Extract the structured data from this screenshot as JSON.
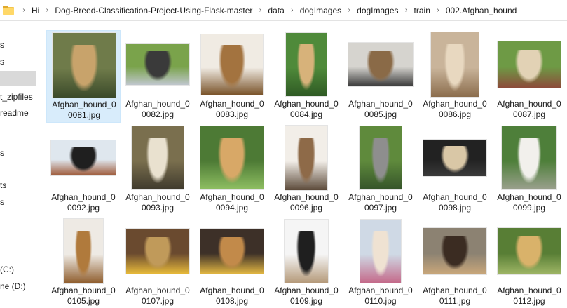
{
  "breadcrumb": {
    "items": [
      "Hi",
      "Dog-Breed-Classification-Project-Using-Flask-master",
      "data",
      "dogImages",
      "dogImages",
      "train",
      "002.Afghan_hound"
    ]
  },
  "nav": {
    "items": [
      {
        "label": "s"
      },
      {
        "label": "s"
      },
      {
        "label": ""
      },
      {
        "label": "t_zipfiles"
      },
      {
        "label": "readme"
      },
      {
        "label": ""
      },
      {
        "label": "s"
      },
      {
        "label": ""
      },
      {
        "label": "ts"
      },
      {
        "label": "s"
      },
      {
        "label": "(C:)"
      },
      {
        "label": "ne (D:)"
      }
    ]
  },
  "files": [
    {
      "line1": "Afghan_hound_0",
      "line2": "0081.jpg",
      "selected": true,
      "colors": [
        "#6f7b4a",
        "#c8a36b",
        "#3b4a2a"
      ]
    },
    {
      "line1": "Afghan_hound_0",
      "line2": "0082.jpg",
      "selected": false,
      "colors": [
        "#7aa34b",
        "#3a3a3a",
        "#bfc6cc"
      ]
    },
    {
      "line1": "Afghan_hound_0",
      "line2": "0083.jpg",
      "selected": false,
      "colors": [
        "#f0ebe3",
        "#a3733f",
        "#7a542b"
      ]
    },
    {
      "line1": "Afghan_hound_0",
      "line2": "0084.jpg",
      "selected": false,
      "colors": [
        "#4f8a3a",
        "#d7b27a",
        "#2f5a24"
      ]
    },
    {
      "line1": "Afghan_hound_0",
      "line2": "0085.jpg",
      "selected": false,
      "colors": [
        "#d6d4cf",
        "#8a6a47",
        "#3a3a3a"
      ]
    },
    {
      "line1": "Afghan_hound_0",
      "line2": "0086.jpg",
      "selected": false,
      "colors": [
        "#c9b49a",
        "#e8d8c0",
        "#8b6d4d"
      ]
    },
    {
      "line1": "Afghan_hound_0",
      "line2": "0087.jpg",
      "selected": false,
      "colors": [
        "#6e9a45",
        "#e2d2b5",
        "#8c4b3a"
      ]
    },
    {
      "line1": "Afghan_hound_0",
      "line2": "0092.jpg",
      "selected": false,
      "colors": [
        "#dfe7ee",
        "#1f1f1f",
        "#9e5a3a"
      ]
    },
    {
      "line1": "Afghan_hound_0",
      "line2": "0093.jpg",
      "selected": false,
      "colors": [
        "#7a6f4e",
        "#e9e1cf",
        "#3f3a2d"
      ]
    },
    {
      "line1": "Afghan_hound_0",
      "line2": "0094.jpg",
      "selected": false,
      "colors": [
        "#4d7a35",
        "#d8a867",
        "#8fbf62"
      ]
    },
    {
      "line1": "Afghan_hound_0",
      "line2": "0096.jpg",
      "selected": false,
      "colors": [
        "#f2eee8",
        "#8e6a48",
        "#5c4a3a"
      ]
    },
    {
      "line1": "Afghan_hound_0",
      "line2": "0097.jpg",
      "selected": false,
      "colors": [
        "#5f8a3c",
        "#8e8e8e",
        "#35542a"
      ]
    },
    {
      "line1": "Afghan_hound_0",
      "line2": "0098.jpg",
      "selected": false,
      "colors": [
        "#222222",
        "#d9c7a6",
        "#3a3a3a"
      ]
    },
    {
      "line1": "Afghan_hound_0",
      "line2": "0099.jpg",
      "selected": false,
      "colors": [
        "#4e7f3a",
        "#f2f0ec",
        "#9aa08d"
      ]
    },
    {
      "line1": "Afghan_hound_0",
      "line2": "0105.jpg",
      "selected": false,
      "colors": [
        "#eeeae4",
        "#b07a3c",
        "#8e5c2c"
      ]
    },
    {
      "line1": "Afghan_hound_0",
      "line2": "0107.jpg",
      "selected": false,
      "colors": [
        "#6a4a2f",
        "#c09a5a",
        "#e6b93a"
      ]
    },
    {
      "line1": "Afghan_hound_0",
      "line2": "0108.jpg",
      "selected": false,
      "colors": [
        "#3d3028",
        "#c28a4a",
        "#e0b542"
      ]
    },
    {
      "line1": "Afghan_hound_0",
      "line2": "0109.jpg",
      "selected": false,
      "colors": [
        "#f5f5f5",
        "#1f1f1f",
        "#b59a7a"
      ]
    },
    {
      "line1": "Afghan_hound_0",
      "line2": "0110.jpg",
      "selected": false,
      "colors": [
        "#cfd9e5",
        "#efe2d2",
        "#c46a8a"
      ]
    },
    {
      "line1": "Afghan_hound_0",
      "line2": "0111.jpg",
      "selected": false,
      "colors": [
        "#8c8272",
        "#3b2c22",
        "#c9a77a"
      ]
    },
    {
      "line1": "Afghan_hound_0",
      "line2": "0112.jpg",
      "selected": false,
      "colors": [
        "#587e35",
        "#d9b26a",
        "#9fb666"
      ]
    }
  ]
}
